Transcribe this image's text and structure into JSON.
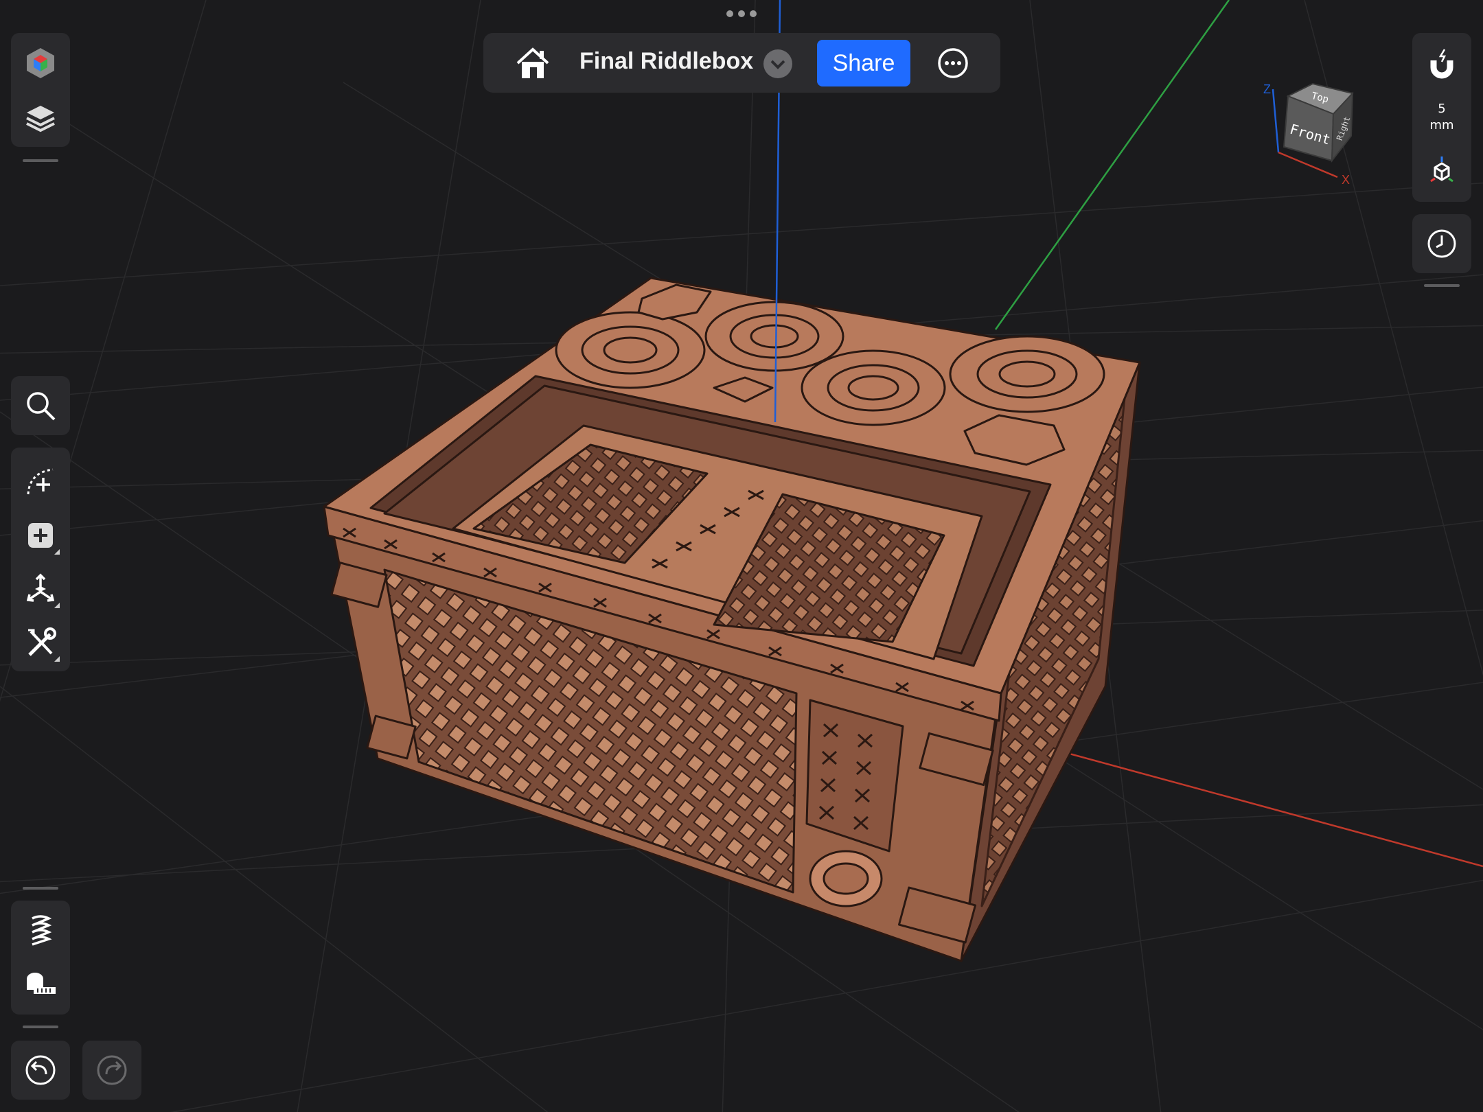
{
  "app": {
    "document_title": "Final Riddlebox",
    "share_label": "Share"
  },
  "view_cube": {
    "top_label": "Top",
    "front_label": "Front",
    "side_label": "Right",
    "axis_z": "Z",
    "axis_x": "X"
  },
  "snap": {
    "value": "5",
    "unit": "mm"
  },
  "icons": {
    "top": [
      "more-dots-icon",
      "home-icon",
      "chevron-down-icon",
      "ellipsis-circle-icon"
    ],
    "left": [
      "object-cube-icon",
      "layers-icon",
      "search-icon",
      "sketch-icon",
      "add-shape-icon",
      "transform-icon",
      "tools-icon",
      "spring-icon",
      "measure-tape-icon",
      "undo-icon",
      "redo-icon"
    ],
    "right": [
      "magnet-icon",
      "axes-cube-icon",
      "history-clock-icon"
    ]
  },
  "colors": {
    "background": "#1b1b1d",
    "panel": "#2a2a2d",
    "accent": "#1f6bff",
    "model": "#b87a5c",
    "axis_x": "#c0392b",
    "axis_y": "#2ea043",
    "axis_z": "#1f5fd6"
  }
}
